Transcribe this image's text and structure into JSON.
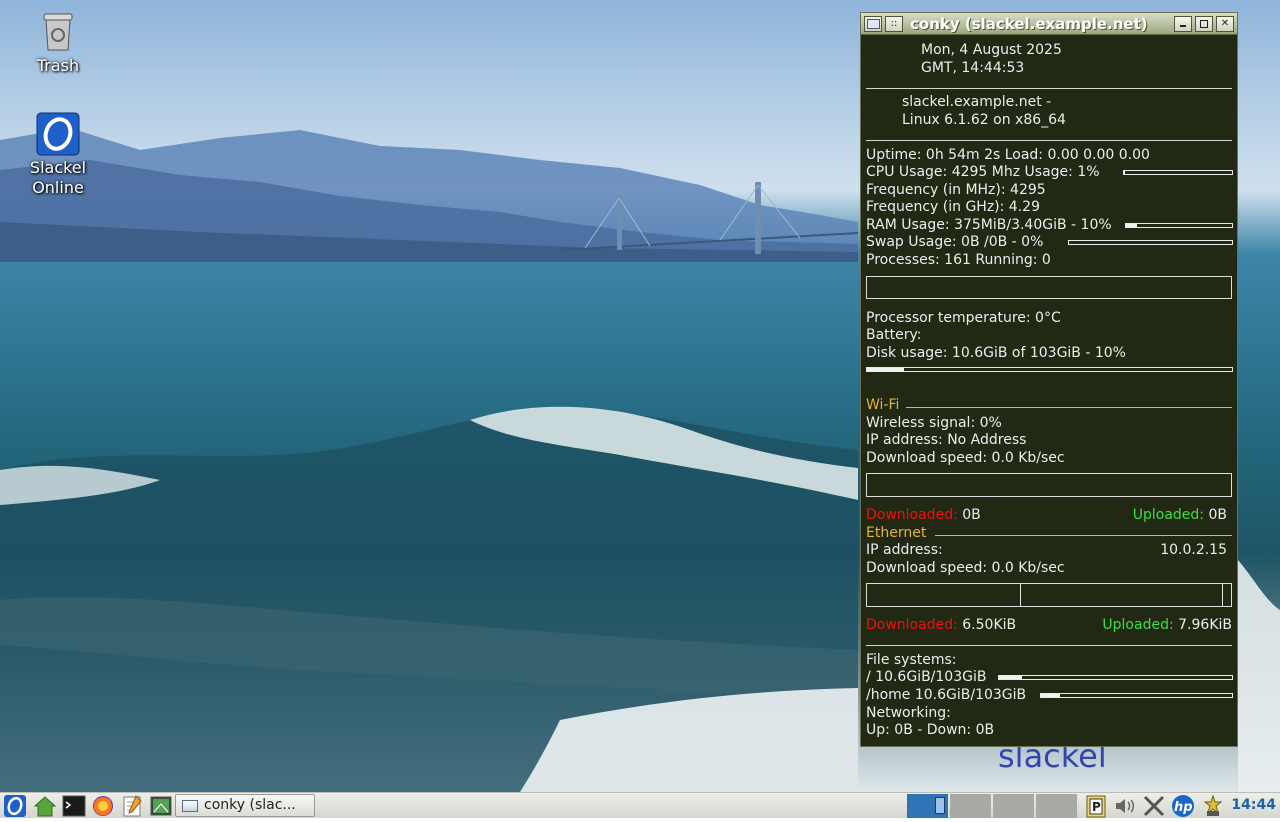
{
  "desktop": {
    "icons": [
      {
        "label": "Trash",
        "icon": "trash-icon"
      },
      {
        "label_line1": "Slackel",
        "label_line2": "Online",
        "icon": "slackel-online-icon"
      }
    ],
    "wallpaper_text": "slackel"
  },
  "conky": {
    "title": "conky (slackel.example.net)",
    "date_line1": "Mon,   4 August 2025",
    "date_line2": "GMT,     14:44:53",
    "host_line1": "slackel.example.net -",
    "host_line2": "Linux 6.1.62 on x86_64",
    "uptime": "Uptime: 0h 54m 2s Load: 0.00 0.00 0.00",
    "cpu": "CPU Usage:  4295 Mhz  Usage: 1%",
    "cpu_usage_fraction": 0.01,
    "freq_mhz": "Frequency (in MHz): 4295",
    "freq_ghz": "Frequency (in GHz): 4.29",
    "ram": "RAM Usage: 375MiB/3.40GiB - 10%",
    "ram_fraction": 0.1,
    "swap": "Swap Usage: 0B  /0B   - 0%",
    "swap_fraction": 0.0,
    "processes": "Processes: 161  Running: 0",
    "temp": "Processor temperature: 0°C",
    "battery": "Battery:",
    "disk": "Disk usage: 10.6GiB of 103GiB - 10%",
    "disk_fraction": 0.1,
    "wifi": {
      "heading": "Wi-Fi",
      "signal": "Wireless signal: 0%",
      "ip": "IP address: No Address",
      "download": "Download speed: 0.0 Kb/sec",
      "downloaded_label": "Downloaded:",
      "downloaded_value": "0B",
      "uploaded_label": "Uploaded:",
      "uploaded_value": "0B"
    },
    "ethernet": {
      "heading": "Ethernet",
      "ip_label": "IP address:",
      "ip_value": "10.0.2.15",
      "download": "Download speed: 0.0 Kb/sec",
      "downloaded_label": "Downloaded:",
      "downloaded_value": "6.50KiB",
      "uploaded_label": "Uploaded:",
      "uploaded_value": "7.96KiB"
    },
    "fs_heading": "File systems:",
    "fs_root": " / 10.6GiB/103GiB",
    "fs_root_fraction": 0.1,
    "fs_home": " /home 10.6GiB/103GiB",
    "fs_home_fraction": 0.1,
    "net_heading": "Networking:",
    "net_line": " Up: 0B     - Down: 0B"
  },
  "taskbar": {
    "task_label": "conky (slac...",
    "clock": "14:44",
    "launchers": [
      "slackel-menu-icon",
      "home-folder-icon",
      "terminal-icon",
      "firefox-icon",
      "text-editor-icon",
      "screenshot-icon"
    ],
    "tray": [
      "parcellite-icon",
      "volume-icon",
      "network-icon",
      "hp-printer-icon",
      "update-icon"
    ],
    "colors": {
      "accent": "#2f74b4",
      "clock": "#1a64a8",
      "conky_bg": "#212915",
      "section": "#e3b53b"
    }
  }
}
